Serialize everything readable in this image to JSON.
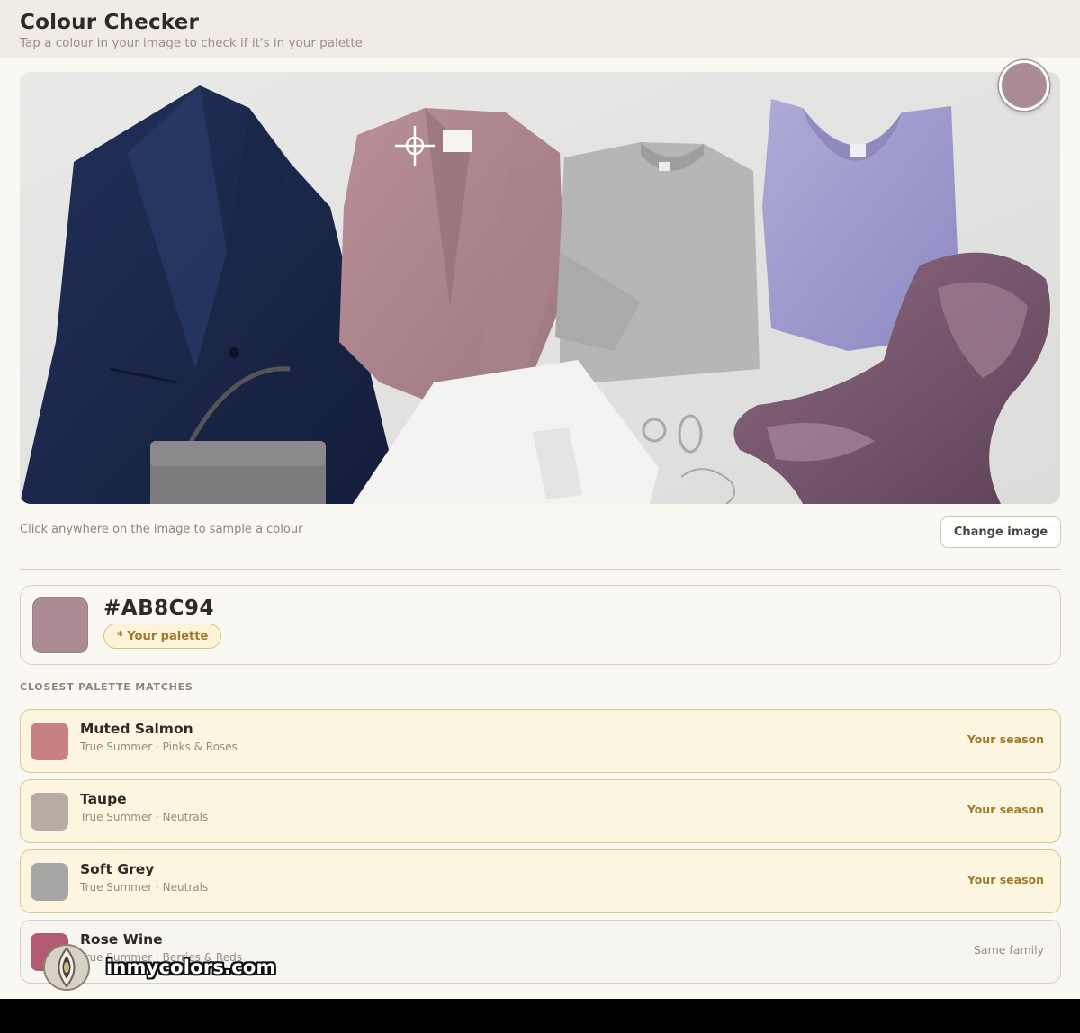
{
  "header": {
    "title": "Colour Checker",
    "subtitle": "Tap a colour in your image to check if it's in your palette"
  },
  "image": {
    "hint": "Click anywhere on the image to sample a colour",
    "change_label": "Change image",
    "sampled_color": "#AB8C94"
  },
  "result": {
    "hex": "#AB8C94",
    "color": "#AB8C94",
    "badge": "* Your palette"
  },
  "matches_label": "CLOSEST PALETTE MATCHES",
  "matches": [
    {
      "name": "Muted Salmon",
      "meta": "True Summer · Pinks & Roses",
      "tag": "Your season",
      "color": "#c88183"
    },
    {
      "name": "Taupe",
      "meta": "True Summer · Neutrals",
      "tag": "Your season",
      "color": "#b8aba2"
    },
    {
      "name": "Soft Grey",
      "meta": "True Summer · Neutrals",
      "tag": "Your season",
      "color": "#a6a6a6"
    },
    {
      "name": "Rose Wine",
      "meta": "True Summer · Berries & Reds",
      "tag": "Same family",
      "color": "#b25a72"
    }
  ],
  "watermark": "inmycolors.com"
}
